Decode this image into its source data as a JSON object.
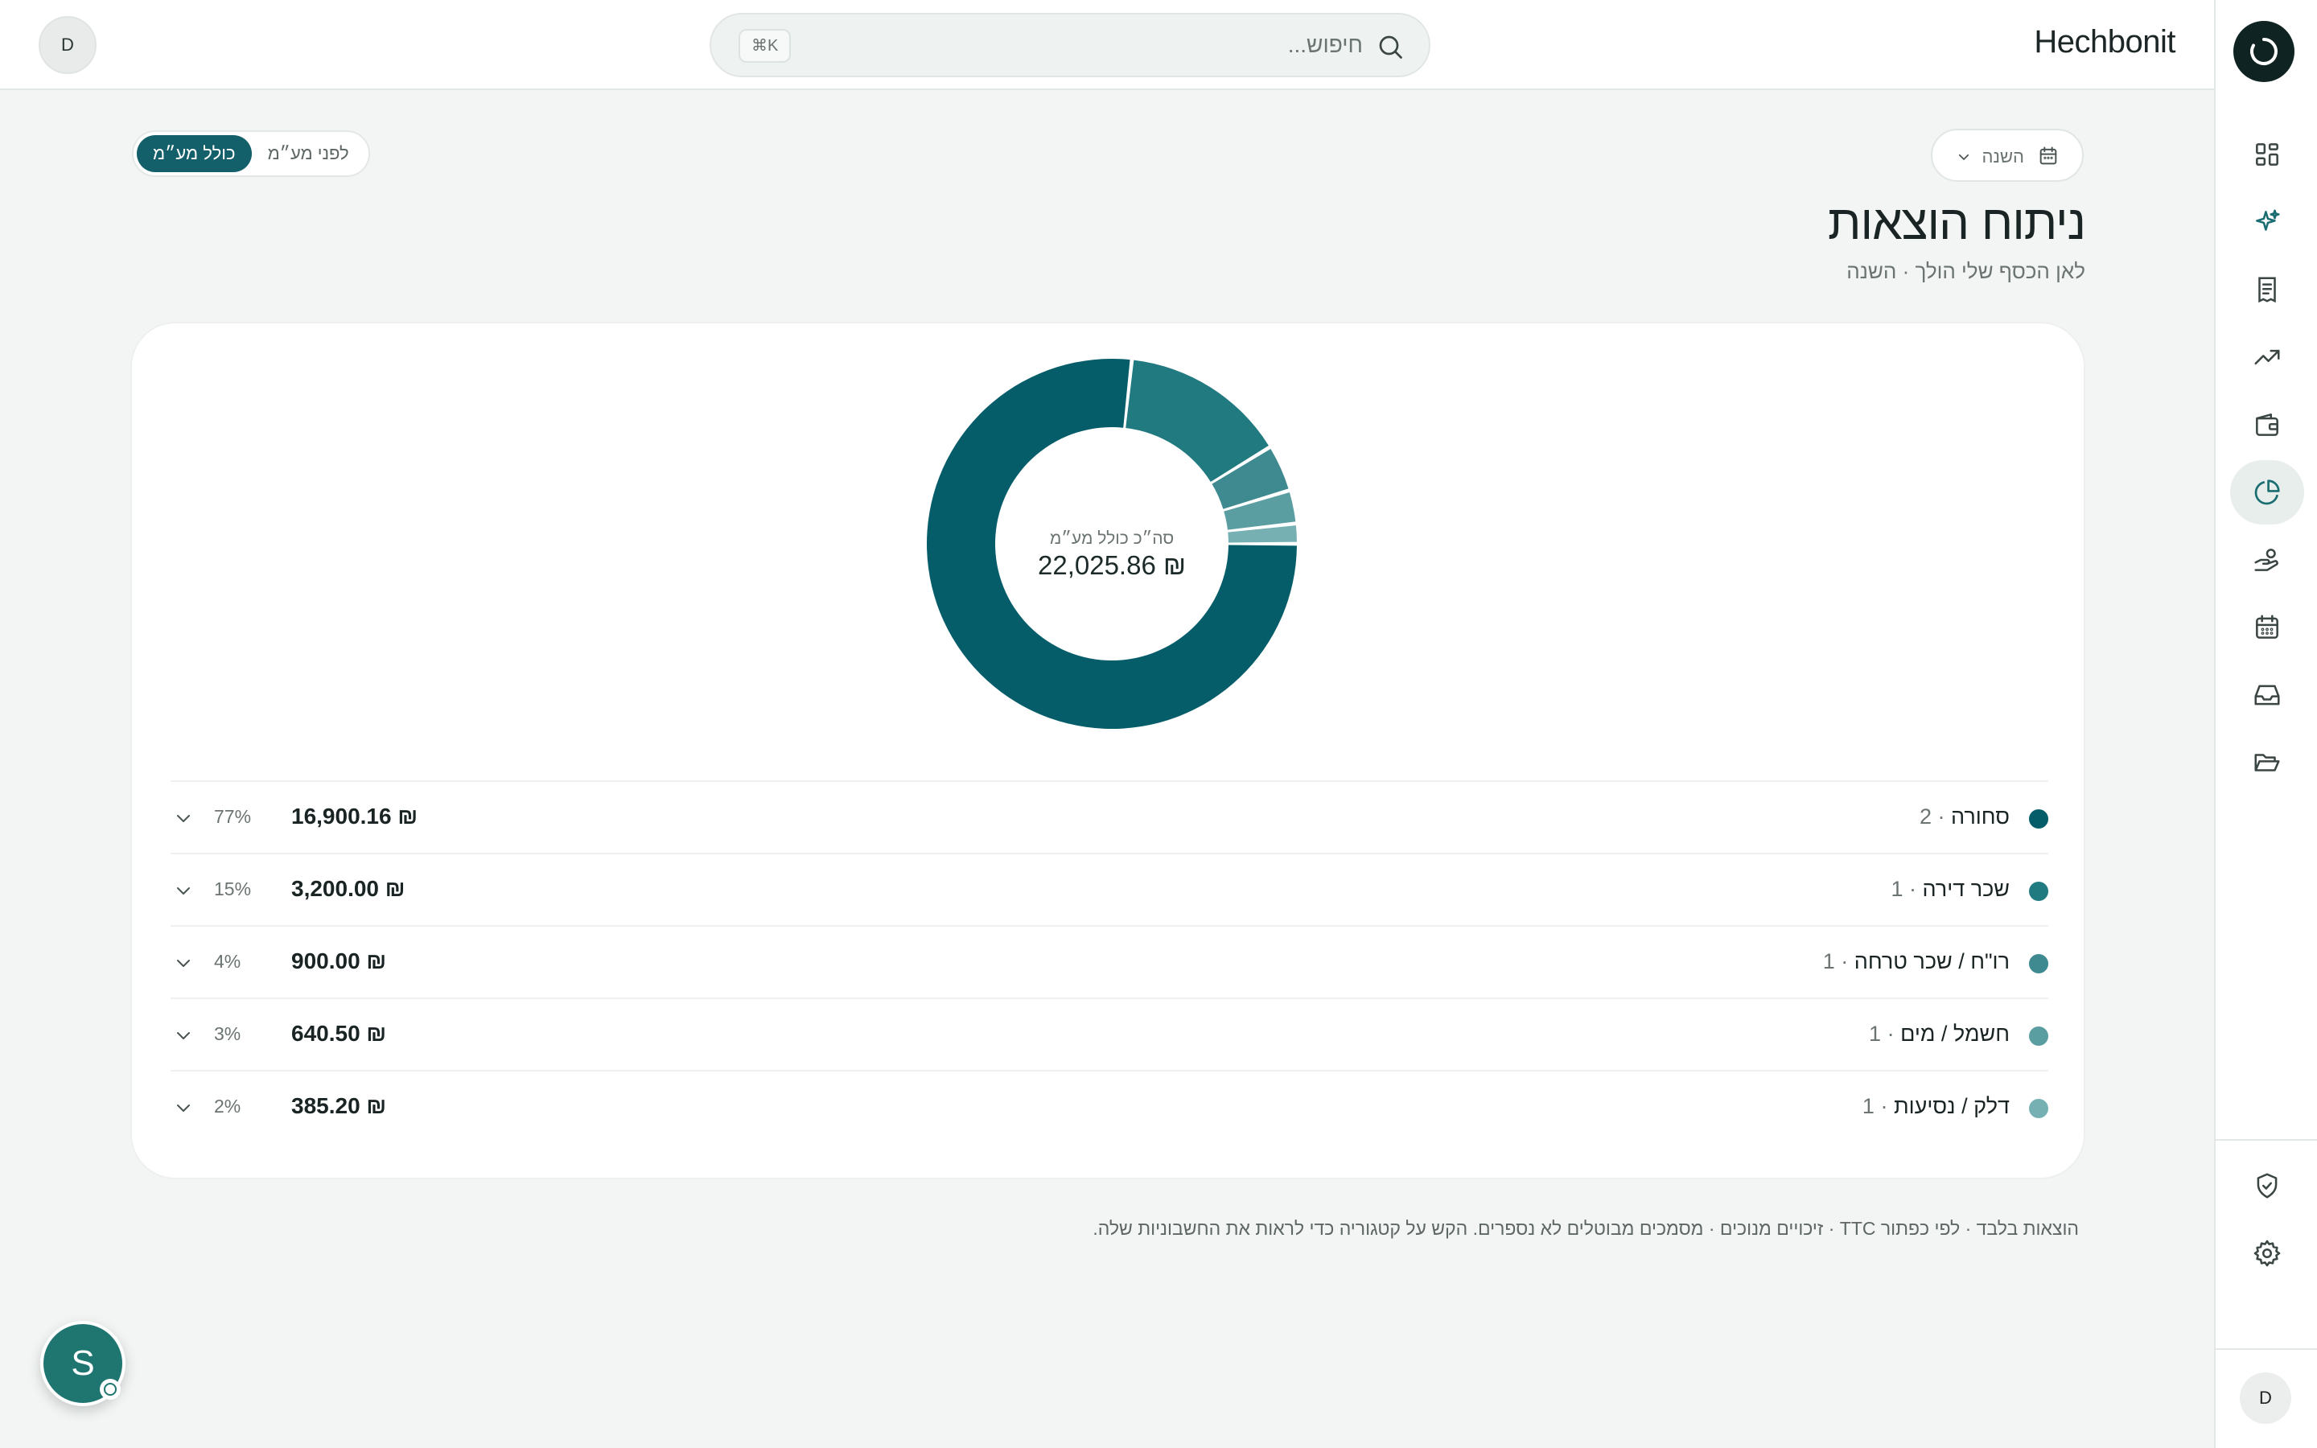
{
  "app": {
    "brand": "Hechbonit"
  },
  "search": {
    "placeholder": "חיפוש...",
    "shortcut": "⌘K"
  },
  "user": {
    "initial": "D"
  },
  "assistant": {
    "initial": "S"
  },
  "sidebar": {
    "items": [
      {
        "icon": "grid-icon",
        "label": "dashboard"
      },
      {
        "icon": "sparkles-icon",
        "label": "assistant"
      },
      {
        "icon": "receipt-icon",
        "label": "receipts"
      },
      {
        "icon": "trending-up-icon",
        "label": "trends"
      },
      {
        "icon": "wallet-icon",
        "label": "wallet"
      },
      {
        "icon": "pie-chart-icon",
        "label": "analysis",
        "active": true
      },
      {
        "icon": "hand-coins-icon",
        "label": "payments"
      },
      {
        "icon": "calendar-icon",
        "label": "calendar"
      },
      {
        "icon": "inbox-icon",
        "label": "inbox"
      },
      {
        "icon": "folder-icon",
        "label": "folders"
      },
      {
        "icon": "shield-check-icon",
        "label": "security"
      },
      {
        "icon": "gear-icon",
        "label": "settings"
      }
    ]
  },
  "filters": {
    "period": "השנה",
    "vat_toggle": {
      "before": "לפני מע״מ",
      "including": "כולל מע״מ",
      "selected": "including"
    }
  },
  "page": {
    "title": "ניתוח הוצאות",
    "subtitle": "לאן הכסף שלי הולך · השנה"
  },
  "chart_data": {
    "type": "pie",
    "variant": "donut",
    "center_label": "סה״כ כולל מע״מ",
    "center_value": "₪ 22,025.86",
    "total": 22025.86,
    "currency_symbol": "₪",
    "categories": [
      "סחורה",
      "שכר דירה",
      "רו\"ח / שכר טרחה",
      "חשמל / מים",
      "דלק / נסיעות"
    ],
    "values": [
      16900.16,
      3200.0,
      900.0,
      640.5,
      385.2
    ],
    "colors": [
      "#065d6a",
      "#217a7f",
      "#3f8a90",
      "#5b9ea2",
      "#76b0b3"
    ]
  },
  "breakdown": [
    {
      "name": "סחורה",
      "count": "2",
      "amount": "16,900.16",
      "pct": "77%",
      "color": "#065d6a"
    },
    {
      "name": "שכר דירה",
      "count": "1",
      "amount": "3,200.00",
      "pct": "15%",
      "color": "#217a7f"
    },
    {
      "name": "רו\"ח / שכר טרחה",
      "count": "1",
      "amount": "900.00",
      "pct": "4%",
      "color": "#3f8a90"
    },
    {
      "name": "חשמל / מים",
      "count": "1",
      "amount": "640.50",
      "pct": "3%",
      "color": "#5b9ea2"
    },
    {
      "name": "דלק / נסיעות",
      "count": "1",
      "amount": "385.20",
      "pct": "2%",
      "color": "#76b0b3"
    }
  ],
  "footnote": "הוצאות בלבד · לפי כפתור TTC · זיכויים מנוכים · מסמכים מבוטלים לא נספרים. הקש על קטגוריה כדי לראות את החשבוניות שלה."
}
